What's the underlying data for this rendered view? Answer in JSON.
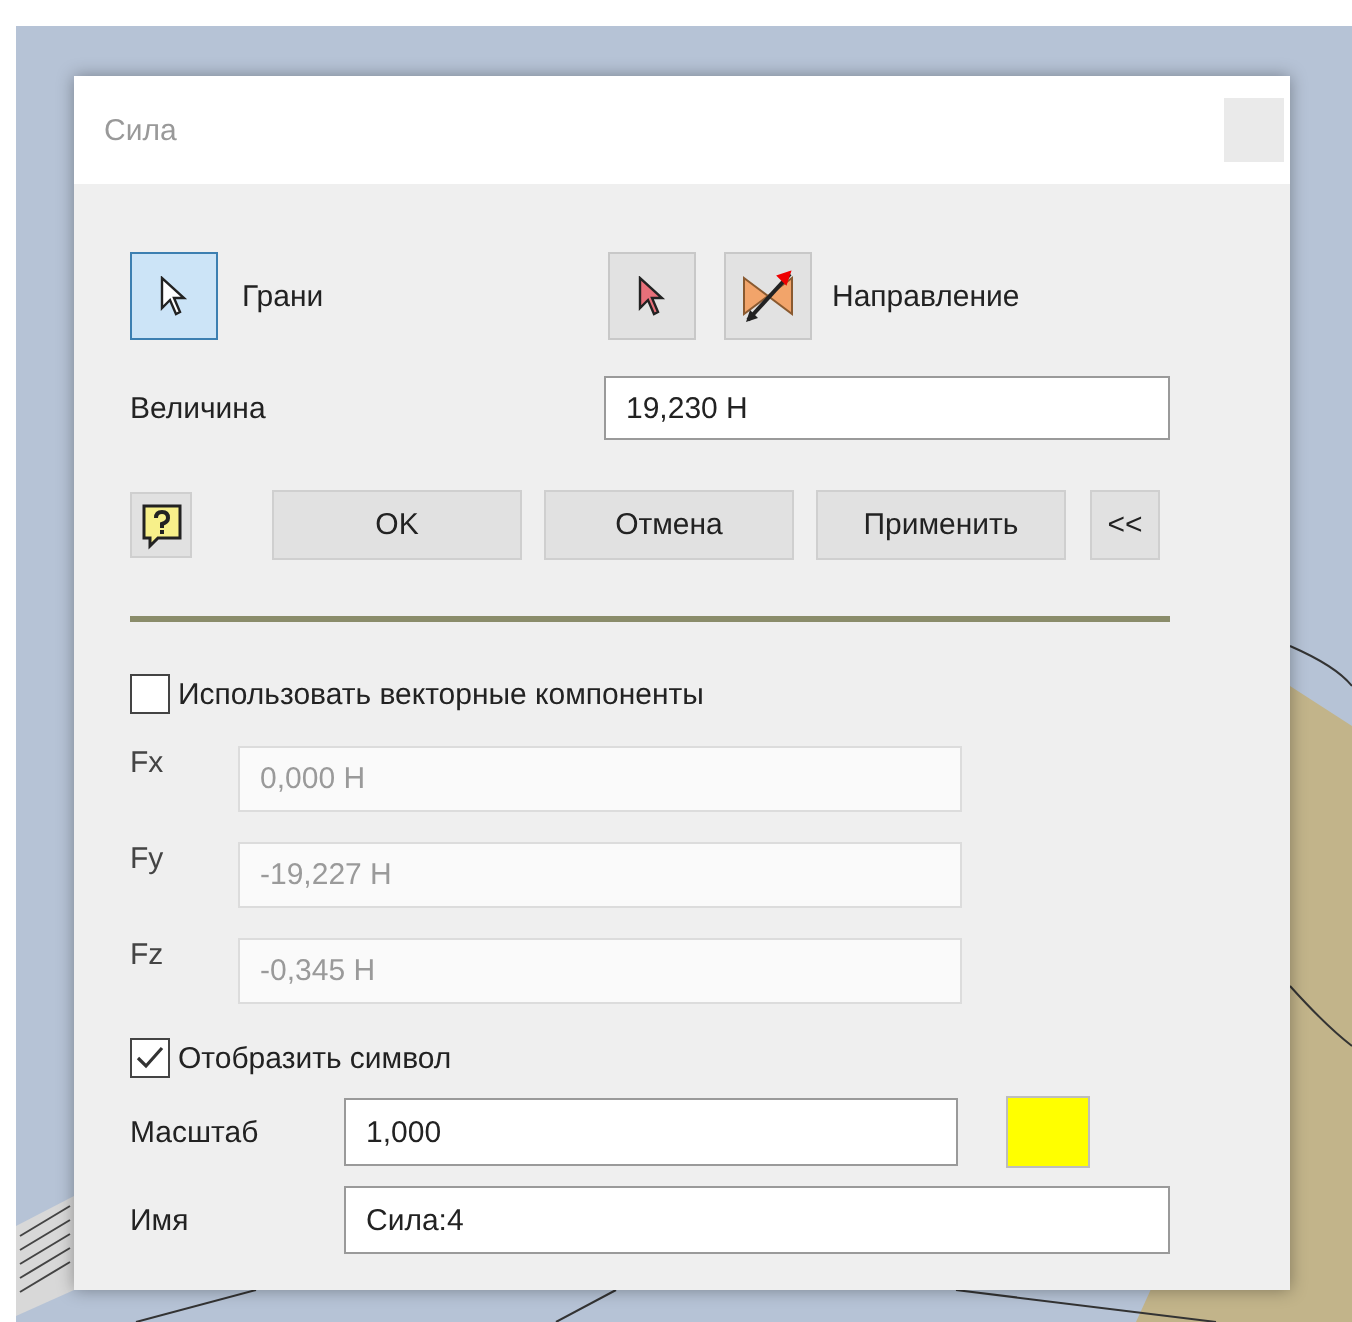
{
  "window": {
    "title": "Сила"
  },
  "selection": {
    "faces": {
      "label": "Грани",
      "selected": true
    },
    "direction": {
      "label": "Направление"
    }
  },
  "magnitude": {
    "label": "Величина",
    "value": "19,230 Н"
  },
  "buttons": [
    "OK",
    "Отмена",
    "Применить",
    "<<"
  ],
  "vector_components": {
    "label": "Использовать векторные компоненты",
    "checked": false,
    "fields": [
      {
        "label": "Fx",
        "value": "0,000 Н",
        "disabled": true
      },
      {
        "label": "Fy",
        "value": "-19,227 Н",
        "disabled": true
      },
      {
        "label": "Fz",
        "value": "-0,345 Н",
        "disabled": true
      }
    ]
  },
  "show_symbol": {
    "label": "Отобразить символ",
    "checked": true
  },
  "scale": {
    "label": "Масштаб",
    "value": "1,000",
    "color": "#ffff00"
  },
  "name": {
    "label": "Имя",
    "value": "Сила:4"
  }
}
